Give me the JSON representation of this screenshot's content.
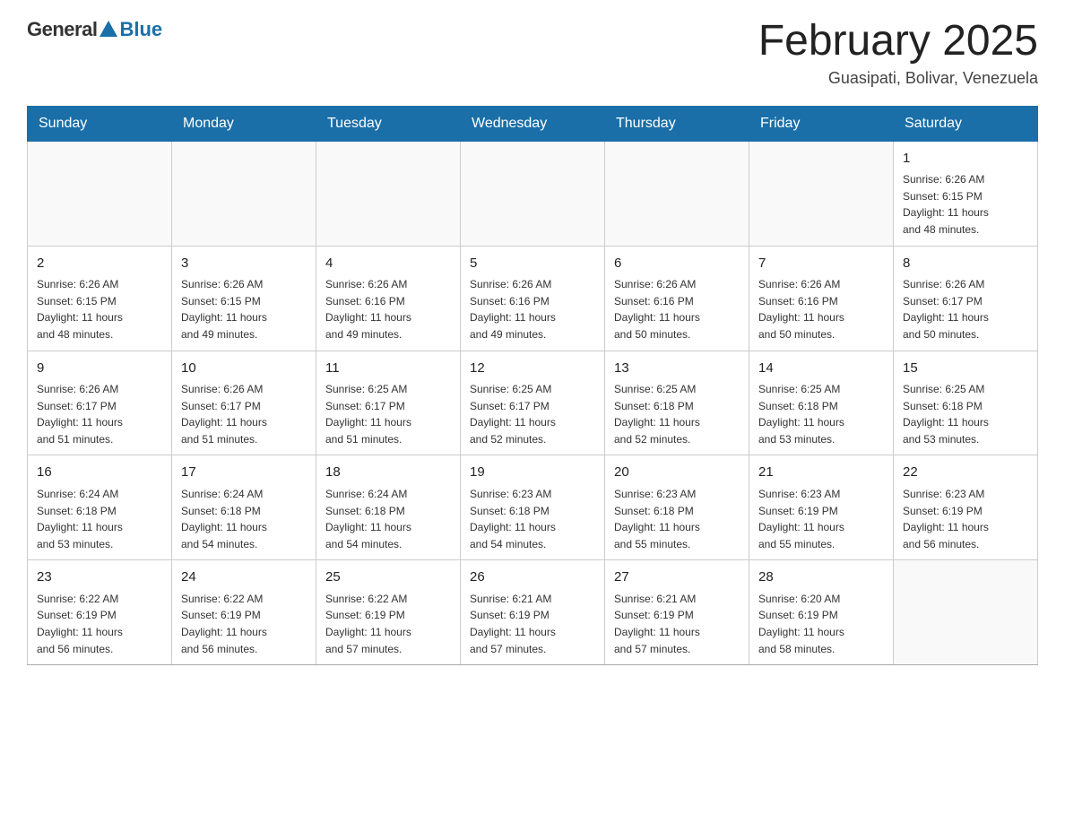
{
  "header": {
    "logo_general": "General",
    "logo_blue": "Blue",
    "title": "February 2025",
    "location": "Guasipati, Bolivar, Venezuela"
  },
  "days_of_week": [
    "Sunday",
    "Monday",
    "Tuesday",
    "Wednesday",
    "Thursday",
    "Friday",
    "Saturday"
  ],
  "weeks": [
    [
      {
        "day": "",
        "info": ""
      },
      {
        "day": "",
        "info": ""
      },
      {
        "day": "",
        "info": ""
      },
      {
        "day": "",
        "info": ""
      },
      {
        "day": "",
        "info": ""
      },
      {
        "day": "",
        "info": ""
      },
      {
        "day": "1",
        "info": "Sunrise: 6:26 AM\nSunset: 6:15 PM\nDaylight: 11 hours\nand 48 minutes."
      }
    ],
    [
      {
        "day": "2",
        "info": "Sunrise: 6:26 AM\nSunset: 6:15 PM\nDaylight: 11 hours\nand 48 minutes."
      },
      {
        "day": "3",
        "info": "Sunrise: 6:26 AM\nSunset: 6:15 PM\nDaylight: 11 hours\nand 49 minutes."
      },
      {
        "day": "4",
        "info": "Sunrise: 6:26 AM\nSunset: 6:16 PM\nDaylight: 11 hours\nand 49 minutes."
      },
      {
        "day": "5",
        "info": "Sunrise: 6:26 AM\nSunset: 6:16 PM\nDaylight: 11 hours\nand 49 minutes."
      },
      {
        "day": "6",
        "info": "Sunrise: 6:26 AM\nSunset: 6:16 PM\nDaylight: 11 hours\nand 50 minutes."
      },
      {
        "day": "7",
        "info": "Sunrise: 6:26 AM\nSunset: 6:16 PM\nDaylight: 11 hours\nand 50 minutes."
      },
      {
        "day": "8",
        "info": "Sunrise: 6:26 AM\nSunset: 6:17 PM\nDaylight: 11 hours\nand 50 minutes."
      }
    ],
    [
      {
        "day": "9",
        "info": "Sunrise: 6:26 AM\nSunset: 6:17 PM\nDaylight: 11 hours\nand 51 minutes."
      },
      {
        "day": "10",
        "info": "Sunrise: 6:26 AM\nSunset: 6:17 PM\nDaylight: 11 hours\nand 51 minutes."
      },
      {
        "day": "11",
        "info": "Sunrise: 6:25 AM\nSunset: 6:17 PM\nDaylight: 11 hours\nand 51 minutes."
      },
      {
        "day": "12",
        "info": "Sunrise: 6:25 AM\nSunset: 6:17 PM\nDaylight: 11 hours\nand 52 minutes."
      },
      {
        "day": "13",
        "info": "Sunrise: 6:25 AM\nSunset: 6:18 PM\nDaylight: 11 hours\nand 52 minutes."
      },
      {
        "day": "14",
        "info": "Sunrise: 6:25 AM\nSunset: 6:18 PM\nDaylight: 11 hours\nand 53 minutes."
      },
      {
        "day": "15",
        "info": "Sunrise: 6:25 AM\nSunset: 6:18 PM\nDaylight: 11 hours\nand 53 minutes."
      }
    ],
    [
      {
        "day": "16",
        "info": "Sunrise: 6:24 AM\nSunset: 6:18 PM\nDaylight: 11 hours\nand 53 minutes."
      },
      {
        "day": "17",
        "info": "Sunrise: 6:24 AM\nSunset: 6:18 PM\nDaylight: 11 hours\nand 54 minutes."
      },
      {
        "day": "18",
        "info": "Sunrise: 6:24 AM\nSunset: 6:18 PM\nDaylight: 11 hours\nand 54 minutes."
      },
      {
        "day": "19",
        "info": "Sunrise: 6:23 AM\nSunset: 6:18 PM\nDaylight: 11 hours\nand 54 minutes."
      },
      {
        "day": "20",
        "info": "Sunrise: 6:23 AM\nSunset: 6:18 PM\nDaylight: 11 hours\nand 55 minutes."
      },
      {
        "day": "21",
        "info": "Sunrise: 6:23 AM\nSunset: 6:19 PM\nDaylight: 11 hours\nand 55 minutes."
      },
      {
        "day": "22",
        "info": "Sunrise: 6:23 AM\nSunset: 6:19 PM\nDaylight: 11 hours\nand 56 minutes."
      }
    ],
    [
      {
        "day": "23",
        "info": "Sunrise: 6:22 AM\nSunset: 6:19 PM\nDaylight: 11 hours\nand 56 minutes."
      },
      {
        "day": "24",
        "info": "Sunrise: 6:22 AM\nSunset: 6:19 PM\nDaylight: 11 hours\nand 56 minutes."
      },
      {
        "day": "25",
        "info": "Sunrise: 6:22 AM\nSunset: 6:19 PM\nDaylight: 11 hours\nand 57 minutes."
      },
      {
        "day": "26",
        "info": "Sunrise: 6:21 AM\nSunset: 6:19 PM\nDaylight: 11 hours\nand 57 minutes."
      },
      {
        "day": "27",
        "info": "Sunrise: 6:21 AM\nSunset: 6:19 PM\nDaylight: 11 hours\nand 57 minutes."
      },
      {
        "day": "28",
        "info": "Sunrise: 6:20 AM\nSunset: 6:19 PM\nDaylight: 11 hours\nand 58 minutes."
      },
      {
        "day": "",
        "info": ""
      }
    ]
  ]
}
